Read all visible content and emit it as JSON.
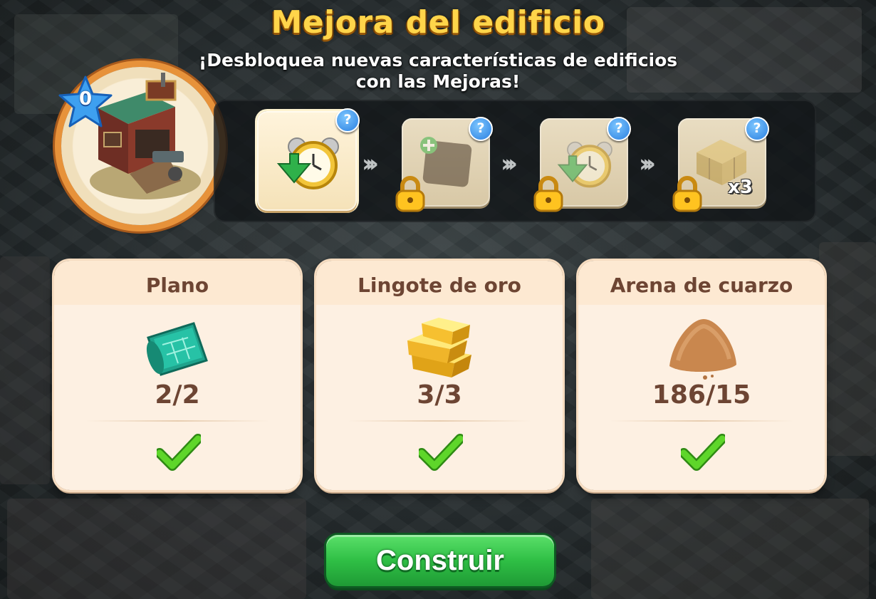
{
  "header": {
    "title": "Mejora del edificio",
    "subtitle_line1": "¡Desbloquea nuevas características de edificios",
    "subtitle_line2": "con las Mejoras!"
  },
  "building": {
    "level": "0",
    "image": "blacksmith-building-icon"
  },
  "upgrade_path": {
    "stages": [
      {
        "icon": "alarm-clock-speedup-icon",
        "state": "active",
        "help": "?"
      },
      {
        "icon": "add-slot-icon",
        "state": "locked",
        "help": "?"
      },
      {
        "icon": "alarm-clock-speedup-icon",
        "state": "locked",
        "help": "?"
      },
      {
        "icon": "hay-bales-icon",
        "state": "locked",
        "help": "?",
        "count": "x3"
      }
    ],
    "arrow_icon": "double-chevron-right-icon"
  },
  "resources": [
    {
      "name": "Plano",
      "icon": "blueprint-icon",
      "amount": "2/2",
      "fulfilled": true
    },
    {
      "name": "Lingote de oro",
      "icon": "gold-ingot-icon",
      "amount": "3/3",
      "fulfilled": true
    },
    {
      "name": "Arena de cuarzo",
      "icon": "quartz-sand-icon",
      "amount": "186/15",
      "fulfilled": true
    }
  ],
  "actions": {
    "build_label": "Construir"
  },
  "colors": {
    "title": "#ffd54a",
    "resource_text": "#6d4533",
    "build_button": "#2fbf45",
    "check": "#4cc21f",
    "help_badge": "#2a7fe0",
    "ring": "#e7923a"
  }
}
